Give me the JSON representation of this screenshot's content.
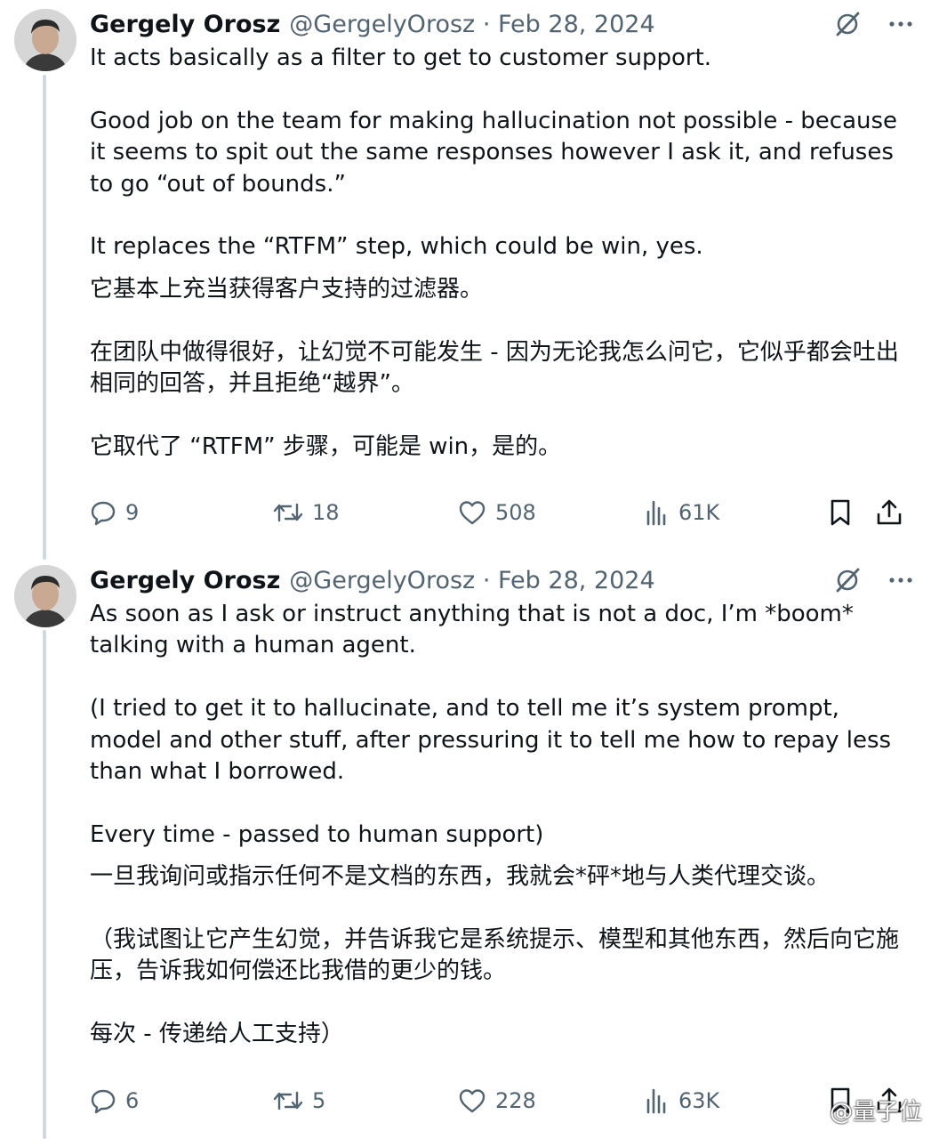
{
  "tweets": [
    {
      "author_name": "Gergely Orosz",
      "author_handle": "@GergelyOrosz",
      "separator": "·",
      "date": "Feb 28, 2024",
      "english_paragraphs": [
        "It acts basically as a filter to get to customer support.",
        "Good job on the team for making hallucination not possible - because it seems to spit out the same responses however I ask it, and refuses to go “out of bounds.”",
        "It replaces the “RTFM” step, which could be win, yes."
      ],
      "chinese_paragraphs": [
        "它基本上充当获得客户支持的过滤器。",
        "在团队中做得很好，让幻觉不可能发生 - 因为无论我怎么问它，它似乎都会吐出相同的回答，并且拒绝“越界”。",
        "它取代了 “RTFM” 步骤，可能是 win，是的。"
      ],
      "stats": {
        "replies": "9",
        "reposts": "18",
        "likes": "508",
        "views": "61K"
      }
    },
    {
      "author_name": "Gergely Orosz",
      "author_handle": "@GergelyOrosz",
      "separator": "·",
      "date": "Feb 28, 2024",
      "english_paragraphs": [
        "As soon as I ask or instruct anything that is not a doc, I’m *boom* talking with a human agent.",
        "(I tried to get it to hallucinate, and to tell me it’s system prompt, model and other stuff, after pressuring it to tell me how to repay less than what I borrowed.",
        "Every time - passed to human support)"
      ],
      "chinese_paragraphs": [
        "一旦我询问或指示任何不是文档的东西，我就会*砰*地与人类代理交谈。",
        "（我试图让它产生幻觉，并告诉我它是系统提示、模型和其他东西，然后向它施压，告诉我如何偿还比我借的更少的钱。",
        "每次 - 传递给人工支持）"
      ],
      "stats": {
        "replies": "6",
        "reposts": "5",
        "likes": "228",
        "views": "63K"
      }
    }
  ],
  "watermark": {
    "text": "@量子位",
    "icon": "weibo-icon"
  },
  "icons": {
    "grok": "grok-icon",
    "more": "more-icon",
    "reply": "reply-icon",
    "repost": "repost-icon",
    "like": "heart-icon",
    "views": "views-icon",
    "bookmark": "bookmark-icon",
    "share": "share-icon"
  },
  "colors": {
    "text": "#0f1419",
    "secondary": "#536471",
    "thread_line": "#cfd9de",
    "background": "#ffffff"
  }
}
